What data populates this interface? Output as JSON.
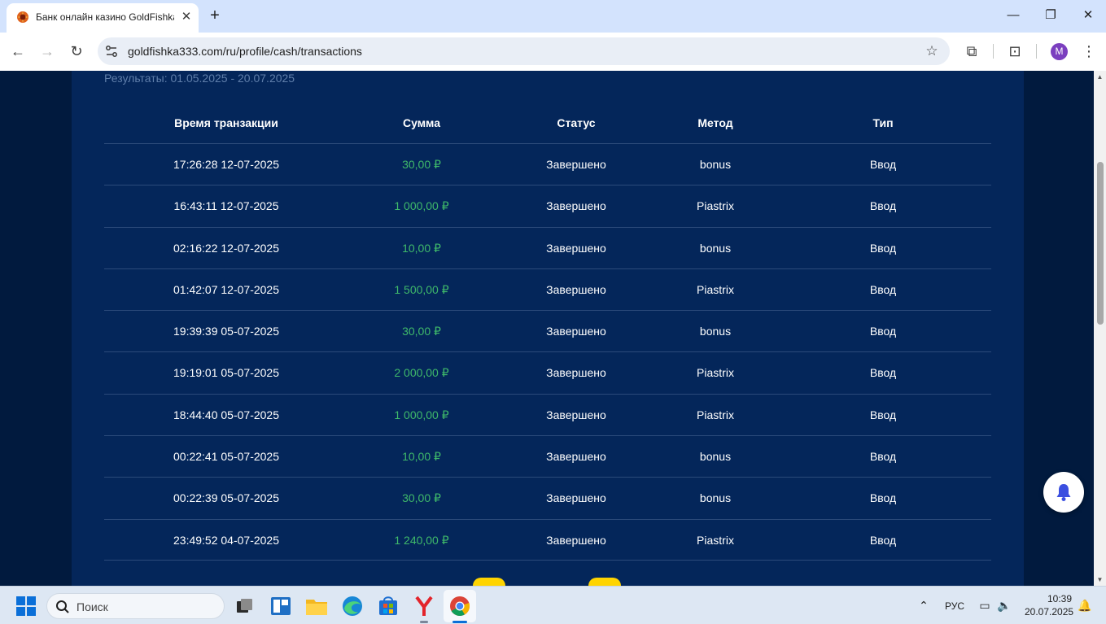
{
  "browser": {
    "tab_title": "Банк онлайн казино GoldFishka",
    "url": "goldfishka333.com/ru/profile/cash/transactions",
    "profile_initial": "M"
  },
  "page": {
    "results_label": "Результаты: 01.05.2025 - 20.07.2025",
    "columns": [
      "Время транзакции",
      "Сумма",
      "Статус",
      "Метод",
      "Тип"
    ],
    "rows": [
      {
        "time": "17:26:28 12-07-2025",
        "amount": "30,00 ₽",
        "status": "Завершено",
        "method": "bonus",
        "type": "Ввод"
      },
      {
        "time": "16:43:11 12-07-2025",
        "amount": "1 000,00 ₽",
        "status": "Завершено",
        "method": "Piastrix",
        "type": "Ввод"
      },
      {
        "time": "02:16:22 12-07-2025",
        "amount": "10,00 ₽",
        "status": "Завершено",
        "method": "bonus",
        "type": "Ввод"
      },
      {
        "time": "01:42:07 12-07-2025",
        "amount": "1 500,00 ₽",
        "status": "Завершено",
        "method": "Piastrix",
        "type": "Ввод"
      },
      {
        "time": "19:39:39 05-07-2025",
        "amount": "30,00 ₽",
        "status": "Завершено",
        "method": "bonus",
        "type": "Ввод"
      },
      {
        "time": "19:19:01 05-07-2025",
        "amount": "2 000,00 ₽",
        "status": "Завершено",
        "method": "Piastrix",
        "type": "Ввод"
      },
      {
        "time": "18:44:40 05-07-2025",
        "amount": "1 000,00 ₽",
        "status": "Завершено",
        "method": "Piastrix",
        "type": "Ввод"
      },
      {
        "time": "00:22:41 05-07-2025",
        "amount": "10,00 ₽",
        "status": "Завершено",
        "method": "bonus",
        "type": "Ввод"
      },
      {
        "time": "00:22:39 05-07-2025",
        "amount": "30,00 ₽",
        "status": "Завершено",
        "method": "bonus",
        "type": "Ввод"
      },
      {
        "time": "23:49:52 04-07-2025",
        "amount": "1 240,00 ₽",
        "status": "Завершено",
        "method": "Piastrix",
        "type": "Ввод"
      }
    ],
    "colors": {
      "background": "#011a3e",
      "panel": "#04265a",
      "amount": "#3fb96a",
      "accent": "#ffd400"
    }
  },
  "taskbar": {
    "search_placeholder": "Поиск",
    "language": "РУС",
    "time": "10:39",
    "date": "20.07.2025"
  }
}
